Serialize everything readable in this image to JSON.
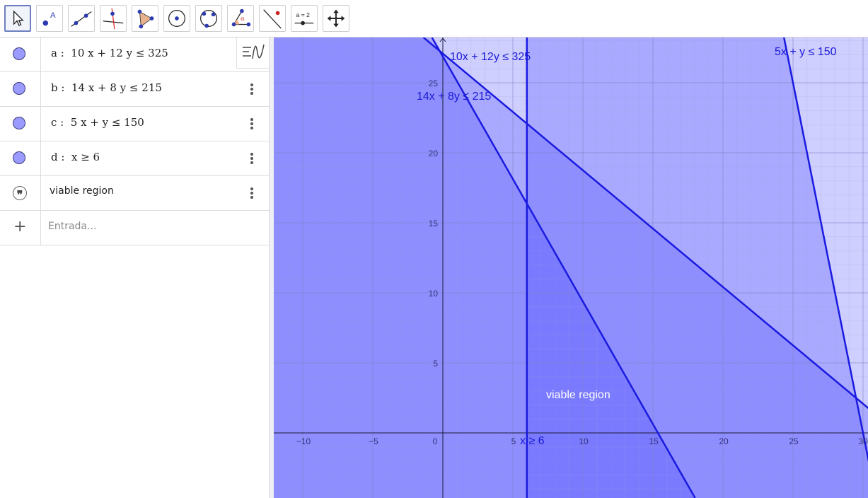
{
  "toolbar": {
    "tools": [
      {
        "name": "move-tool",
        "selected": true
      },
      {
        "name": "point-tool"
      },
      {
        "name": "line-tool"
      },
      {
        "name": "perpendicular-line-tool"
      },
      {
        "name": "polygon-tool"
      },
      {
        "name": "circle-center-point-tool"
      },
      {
        "name": "circle-three-points-tool"
      },
      {
        "name": "angle-tool"
      },
      {
        "name": "reflect-tool"
      },
      {
        "name": "slider-tool",
        "label": "a = 2"
      },
      {
        "name": "move-graphics-view-tool"
      }
    ]
  },
  "algebra": {
    "rows": [
      {
        "id": "a",
        "formula": "a :  10 x + 12 y ≤ 325"
      },
      {
        "id": "b",
        "formula": "b :  14 x + 8 y ≤ 215"
      },
      {
        "id": "c",
        "formula": "c :  5 x + y ≤ 150"
      },
      {
        "id": "d",
        "formula": "d :  x ≥ 6"
      },
      {
        "id": "text1",
        "text": "viable region"
      }
    ],
    "input_placeholder": "Entrada..."
  },
  "graphics": {
    "x_ticks": [
      "−10",
      "−5",
      "0",
      "5",
      "10",
      "15",
      "20",
      "25",
      "30"
    ],
    "y_ticks": [
      "5",
      "10",
      "15",
      "20",
      "25"
    ],
    "captions": {
      "a": "10x + 12y ≤ 325",
      "b": "14x + 8y ≤ 215",
      "c": "5x + y ≤ 150",
      "d": "x ≥ 6"
    },
    "region_label": "viable region",
    "colors": {
      "fill": "#4040ff",
      "line": "#1a1ae0",
      "marble": "#9b9bff"
    }
  }
}
